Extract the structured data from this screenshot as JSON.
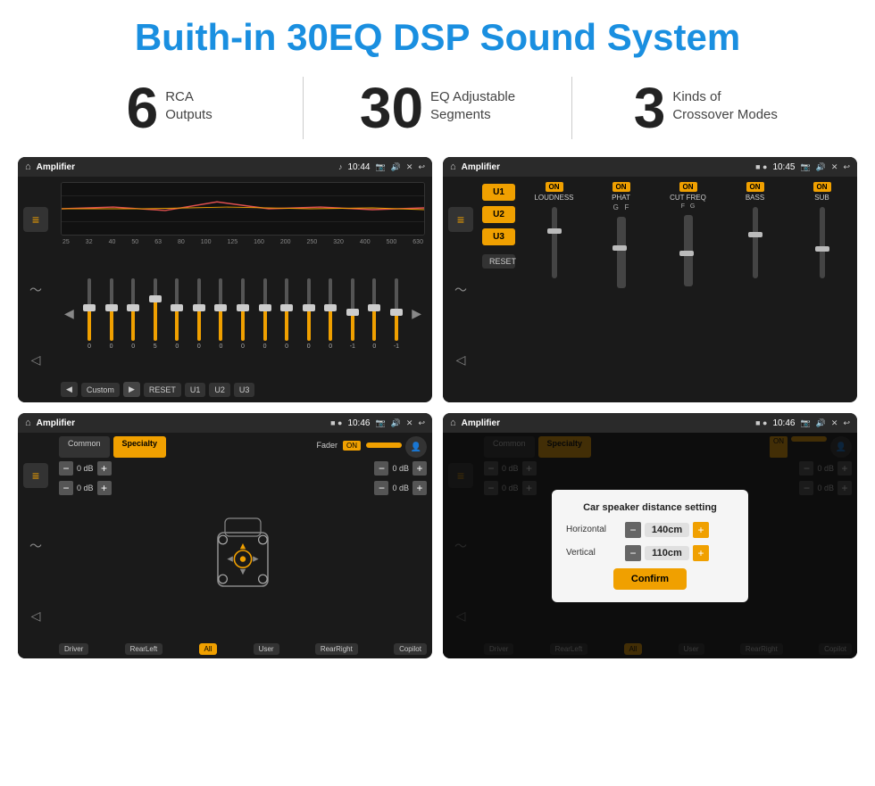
{
  "page": {
    "title": "Buith-in 30EQ DSP Sound System"
  },
  "stats": [
    {
      "number": "6",
      "label": "RCA\nOutputs"
    },
    {
      "number": "30",
      "label": "EQ Adjustable\nSegments"
    },
    {
      "number": "3",
      "label": "Kinds of\nCrossover Modes"
    }
  ],
  "screens": {
    "eq": {
      "title": "Amplifier",
      "time": "10:44",
      "freqs": [
        "25",
        "32",
        "40",
        "50",
        "63",
        "80",
        "100",
        "125",
        "160",
        "200",
        "250",
        "320",
        "400",
        "500",
        "630"
      ],
      "values": [
        "0",
        "0",
        "0",
        "5",
        "0",
        "0",
        "0",
        "0",
        "0",
        "0",
        "0",
        "0",
        "-1",
        "0",
        "-1"
      ],
      "buttons": [
        "Custom",
        "RESET",
        "U1",
        "U2",
        "U3"
      ]
    },
    "crossover": {
      "title": "Amplifier",
      "time": "10:45",
      "tabs": [
        "U1",
        "U2",
        "U3"
      ],
      "controls": [
        {
          "label": "LOUDNESS",
          "on": true
        },
        {
          "label": "PHAT",
          "on": true
        },
        {
          "label": "CUT FREQ",
          "on": true
        },
        {
          "label": "BASS",
          "on": true
        },
        {
          "label": "SUB",
          "on": true
        }
      ],
      "reset": "RESET"
    },
    "speaker": {
      "title": "Amplifier",
      "time": "10:46",
      "modes": [
        {
          "label": "Common",
          "active": false
        },
        {
          "label": "Specialty",
          "active": true
        }
      ],
      "fader": "Fader",
      "faderOn": "ON",
      "bottomLabels": [
        "Driver",
        "RearLeft",
        "All",
        "User",
        "RearRight",
        "Copilot"
      ]
    },
    "distance": {
      "title": "Amplifier",
      "time": "10:46",
      "modes": [
        {
          "label": "Common",
          "active": false
        },
        {
          "label": "Specialty",
          "active": true
        }
      ],
      "dialog": {
        "title": "Car speaker distance setting",
        "rows": [
          {
            "label": "Horizontal",
            "value": "140cm"
          },
          {
            "label": "Vertical",
            "value": "110cm"
          }
        ],
        "confirm": "Confirm"
      }
    }
  }
}
